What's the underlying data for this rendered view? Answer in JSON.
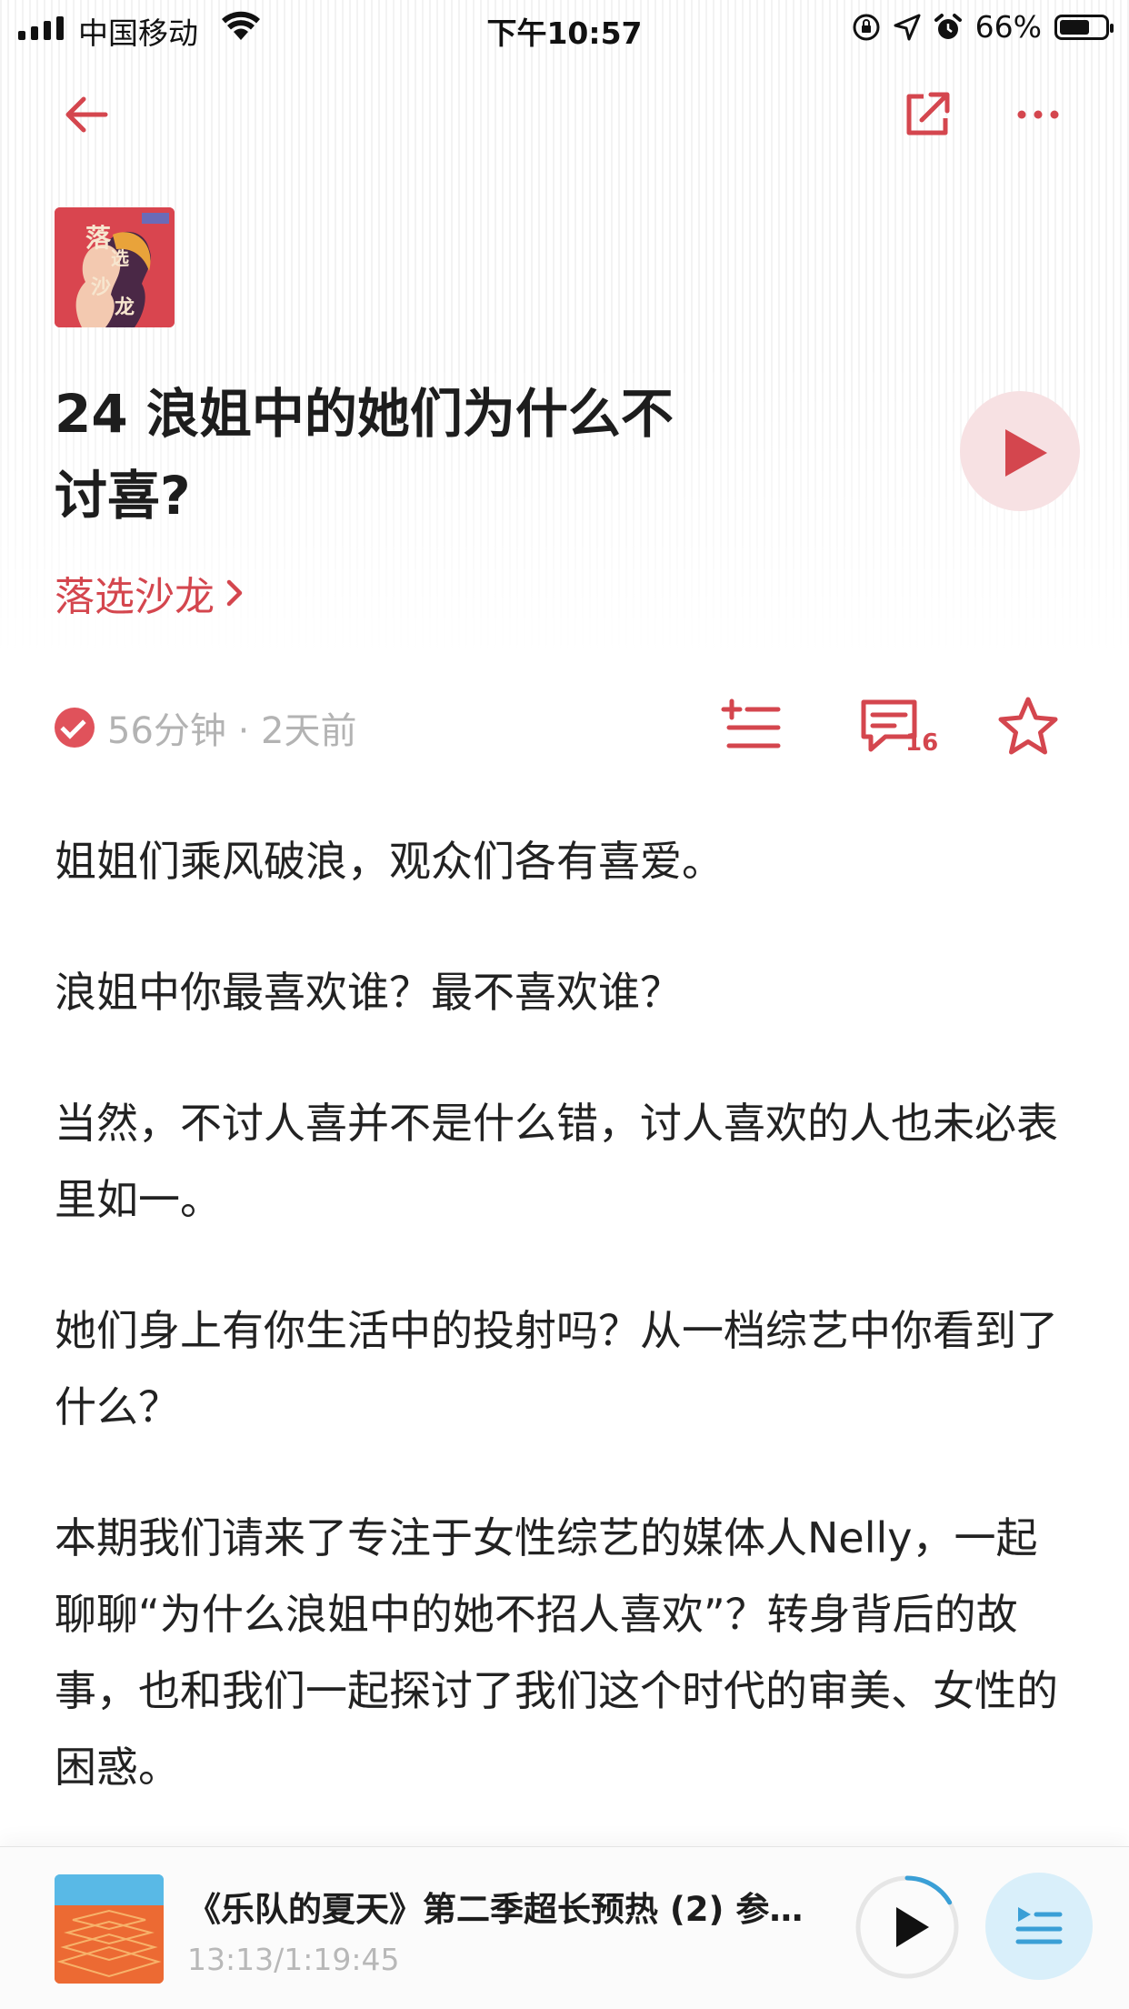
{
  "status_bar": {
    "carrier": "中国移动",
    "time": "下午10:57",
    "battery": "66%",
    "battery_level": 0.66
  },
  "nav": {
    "back_icon": "arrow-left-icon",
    "share_icon": "share-icon",
    "more_icon": "more-icon"
  },
  "episode": {
    "cover_text": [
      "落",
      "选",
      "沙",
      "龙"
    ],
    "title": "24 浪姐中的她们为什么不讨喜?",
    "podcast_name": "落选沙龙",
    "duration_time": "56分钟 · 2天前",
    "comment_count": "16"
  },
  "description": [
    "姐姐们乘风破浪，观众们各有喜爱。",
    "浪姐中你最喜欢谁？最不喜欢谁？",
    "当然，不讨人喜并不是什么错，讨人喜欢的人也未必表里如一。",
    "她们身上有你生活中的投射吗？从一档综艺中你看到了什么？",
    "本期我们请来了专注于女性综艺的媒体人Nelly，一起聊聊“为什么浪姐中的她不招人喜欢”？转身背后的故事，也和我们一起探讨了我们这个时代的审美、女性的困惑。"
  ],
  "mini_player": {
    "title": "《乐队的夏天》第二季超长预热 (2) 参…",
    "progress": "13:13/1:19:45",
    "progress_fraction": 0.166
  },
  "colors": {
    "accent": "#d4464e",
    "accent_light": "#f7e1e3",
    "muted": "#b3b3b3",
    "queue_bg": "#d9effa",
    "queue_icon": "#3a9fd6"
  }
}
